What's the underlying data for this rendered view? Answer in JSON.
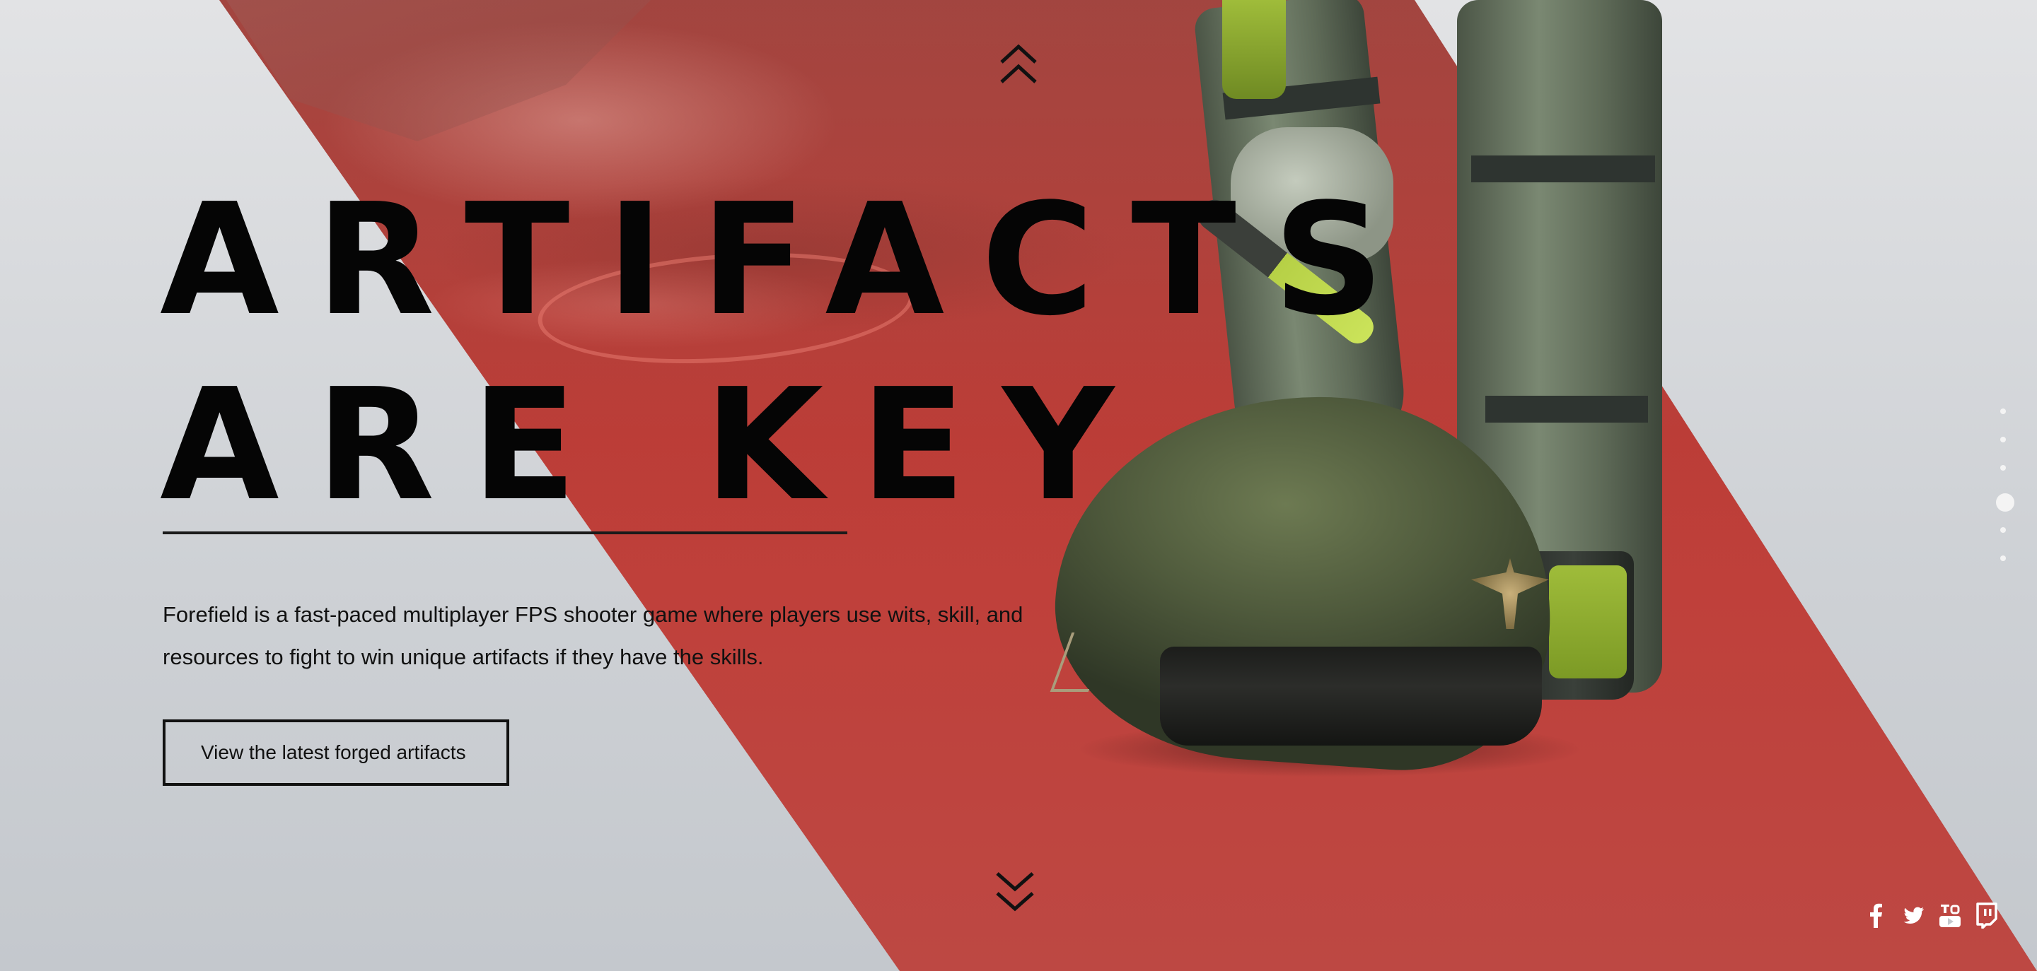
{
  "hero": {
    "headline_line1": "ARTIFACTS",
    "headline_line2": "ARE KEY",
    "description": "Forefield is a fast-paced multiplayer FPS shooter game where players use wits, skill, and resources to fight to win unique artifacts if they have the skills.",
    "cta_label": "View the latest forged artifacts"
  },
  "navigation": {
    "prev_icon": "double-chevron-up-icon",
    "next_icon": "double-chevron-down-icon",
    "page_dots": {
      "count": 6,
      "active_index": 3
    }
  },
  "social": [
    "facebook-icon",
    "twitter-icon",
    "youtube-icon",
    "twitch-icon"
  ],
  "colors": {
    "accent_red": "#c03d37",
    "background": "#d7d9dc",
    "text": "#050505"
  }
}
